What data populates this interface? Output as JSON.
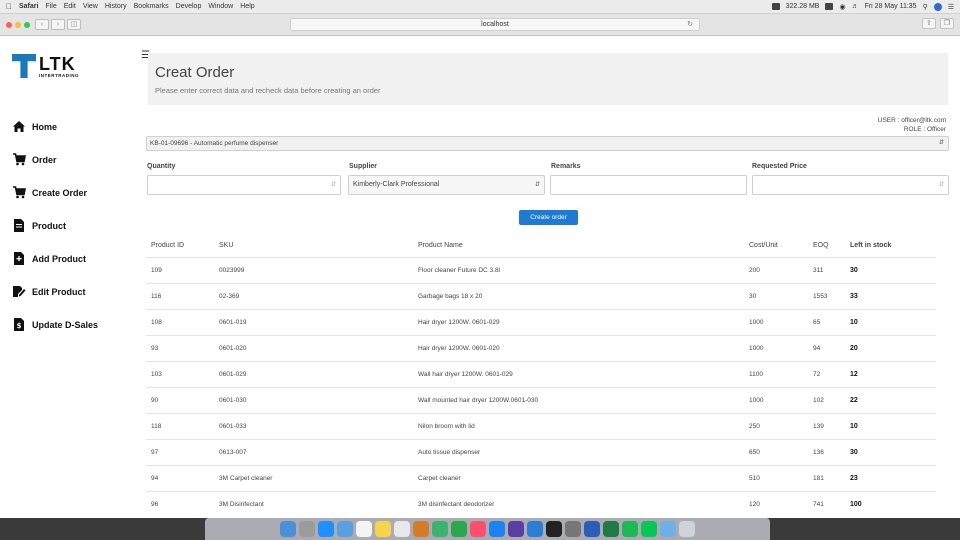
{
  "menubar": {
    "apple": "",
    "app": "Safari",
    "items": [
      "File",
      "Edit",
      "View",
      "History",
      "Bookmarks",
      "Develop",
      "Window",
      "Help"
    ],
    "memory": "322.28 MB",
    "datetime": "Fri 28 May 11:35"
  },
  "browser": {
    "url": "localhost"
  },
  "sidebar": {
    "logo": "LTK",
    "logo_sub": "INTERTRADING",
    "items": [
      {
        "label": "Home",
        "icon": "home-icon"
      },
      {
        "label": "Order",
        "icon": "cart-icon"
      },
      {
        "label": "Create Order",
        "icon": "cart-icon"
      },
      {
        "label": "Product",
        "icon": "file-icon"
      },
      {
        "label": "Add Product",
        "icon": "file-plus-icon"
      },
      {
        "label": "Edit Product",
        "icon": "edit-icon"
      },
      {
        "label": "Update D-Sales",
        "icon": "file-dollar-icon"
      }
    ]
  },
  "header": {
    "title": "Creat Order",
    "subtitle": "Please enter correct data and recheck data before creating an order"
  },
  "user": {
    "line1": "USER : officer@ltk.com",
    "line2": "ROLE : Officer"
  },
  "form": {
    "product": "KB-01-09696 - Automatic perfume dispenser",
    "quantity_label": "Quantity",
    "supplier_label": "Supplier",
    "supplier_value": "Kimberly-Clark Professional",
    "remarks_label": "Remarks",
    "price_label": "Requested Price",
    "submit": "Create order"
  },
  "table": {
    "headers": [
      "Product ID",
      "SKU",
      "Product Name",
      "Cost/Unit",
      "EOQ",
      "Left in stock"
    ],
    "rows": [
      [
        "109",
        "0023999",
        "Floor cleaner Future DC 3.8l",
        "200",
        "311",
        "30"
      ],
      [
        "116",
        "02-369",
        "Garbage bags 18 x 20",
        "30",
        "1553",
        "33"
      ],
      [
        "108",
        "0601-019",
        "Hair dryer 1200W. 0601-029",
        "1000",
        "65",
        "10"
      ],
      [
        "93",
        "0601-020",
        "Hair dryer 1200W. 0601-020",
        "1000",
        "94",
        "20"
      ],
      [
        "103",
        "0601-029",
        "Wall hair dryer 1200W. 0601-029",
        "1100",
        "72",
        "12"
      ],
      [
        "90",
        "0601-030",
        "Wall mounted hair dryer 1200W.0601-030",
        "1000",
        "102",
        "22"
      ],
      [
        "118",
        "0601-033",
        "Nilon broom with lid",
        "250",
        "139",
        "10"
      ],
      [
        "97",
        "0613-007",
        "Auto tissue dispenser",
        "650",
        "136",
        "30"
      ],
      [
        "94",
        "3M Carpet cleaner",
        "Carpet cleaner",
        "510",
        "181",
        "23"
      ],
      [
        "96",
        "3M Disinfectant",
        "3M disinfectant deodorizer",
        "120",
        "741",
        "100"
      ]
    ]
  },
  "colors": {
    "accent": "#1f7bd1",
    "logo": "#1a7ab8",
    "header_bg": "#f1f1f1"
  }
}
